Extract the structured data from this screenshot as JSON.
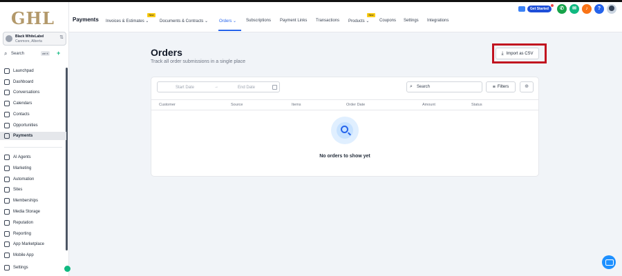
{
  "sidebar": {
    "logo": "GHL",
    "account": {
      "name": "Black WhiteLabel",
      "location": "Canmore, Alberta"
    },
    "search": {
      "label": "Search",
      "shortcut": "ctrl K"
    },
    "items_top": [
      {
        "label": "Launchpad",
        "icon": "rocket-icon"
      },
      {
        "label": "Dashboard",
        "icon": "grid-icon"
      },
      {
        "label": "Conversations",
        "icon": "chat-icon"
      },
      {
        "label": "Calendars",
        "icon": "calendar-icon"
      },
      {
        "label": "Contacts",
        "icon": "contacts-icon"
      },
      {
        "label": "Opportunities",
        "icon": "opportunities-icon"
      },
      {
        "label": "Payments",
        "icon": "payments-icon",
        "active": true
      }
    ],
    "items_bottom": [
      {
        "label": "AI Agents",
        "icon": "sparkle-icon"
      },
      {
        "label": "Marketing",
        "icon": "send-icon"
      },
      {
        "label": "Automation",
        "icon": "automation-icon"
      },
      {
        "label": "Sites",
        "icon": "sites-icon"
      },
      {
        "label": "Memberships",
        "icon": "memberships-icon"
      },
      {
        "label": "Media Storage",
        "icon": "media-icon"
      },
      {
        "label": "Reputation",
        "icon": "star-icon"
      },
      {
        "label": "Reporting",
        "icon": "chart-icon"
      },
      {
        "label": "App Marketplace",
        "icon": "marketplace-icon"
      },
      {
        "label": "Mobile App",
        "icon": "mobile-icon"
      },
      {
        "label": "Settings",
        "icon": "gear-icon"
      }
    ]
  },
  "topnav": {
    "section": "Payments",
    "tabs": [
      {
        "label": "Invoices & Estimates",
        "dropdown": true,
        "badge": "New"
      },
      {
        "label": "Documents & Contracts",
        "dropdown": true
      },
      {
        "label": "Orders",
        "dropdown": true,
        "active": true
      },
      {
        "label": "Subscriptions"
      },
      {
        "label": "Payment Links"
      },
      {
        "label": "Transactions"
      },
      {
        "label": "Products",
        "dropdown": true,
        "badge": "New"
      },
      {
        "label": "Coupons"
      },
      {
        "label": "Settings"
      },
      {
        "label": "Integrations"
      }
    ],
    "get_started": "Get Started",
    "colors": {
      "accent": "#2563eb",
      "phone": "#16a34a",
      "megaphone": "#10b981",
      "bell": "#f97316",
      "help": "#2563eb"
    }
  },
  "main": {
    "title": "Orders",
    "subtitle": "Track all order submissions in a single place",
    "import_label": "Import as CSV",
    "date_start_placeholder": "Start Date",
    "date_end_placeholder": "End Date",
    "search_placeholder": "Search",
    "filters_label": "Filters",
    "columns": [
      "Customer",
      "Source",
      "Items",
      "Order Date",
      "Amount",
      "Status"
    ],
    "empty_message": "No orders to show yet"
  }
}
